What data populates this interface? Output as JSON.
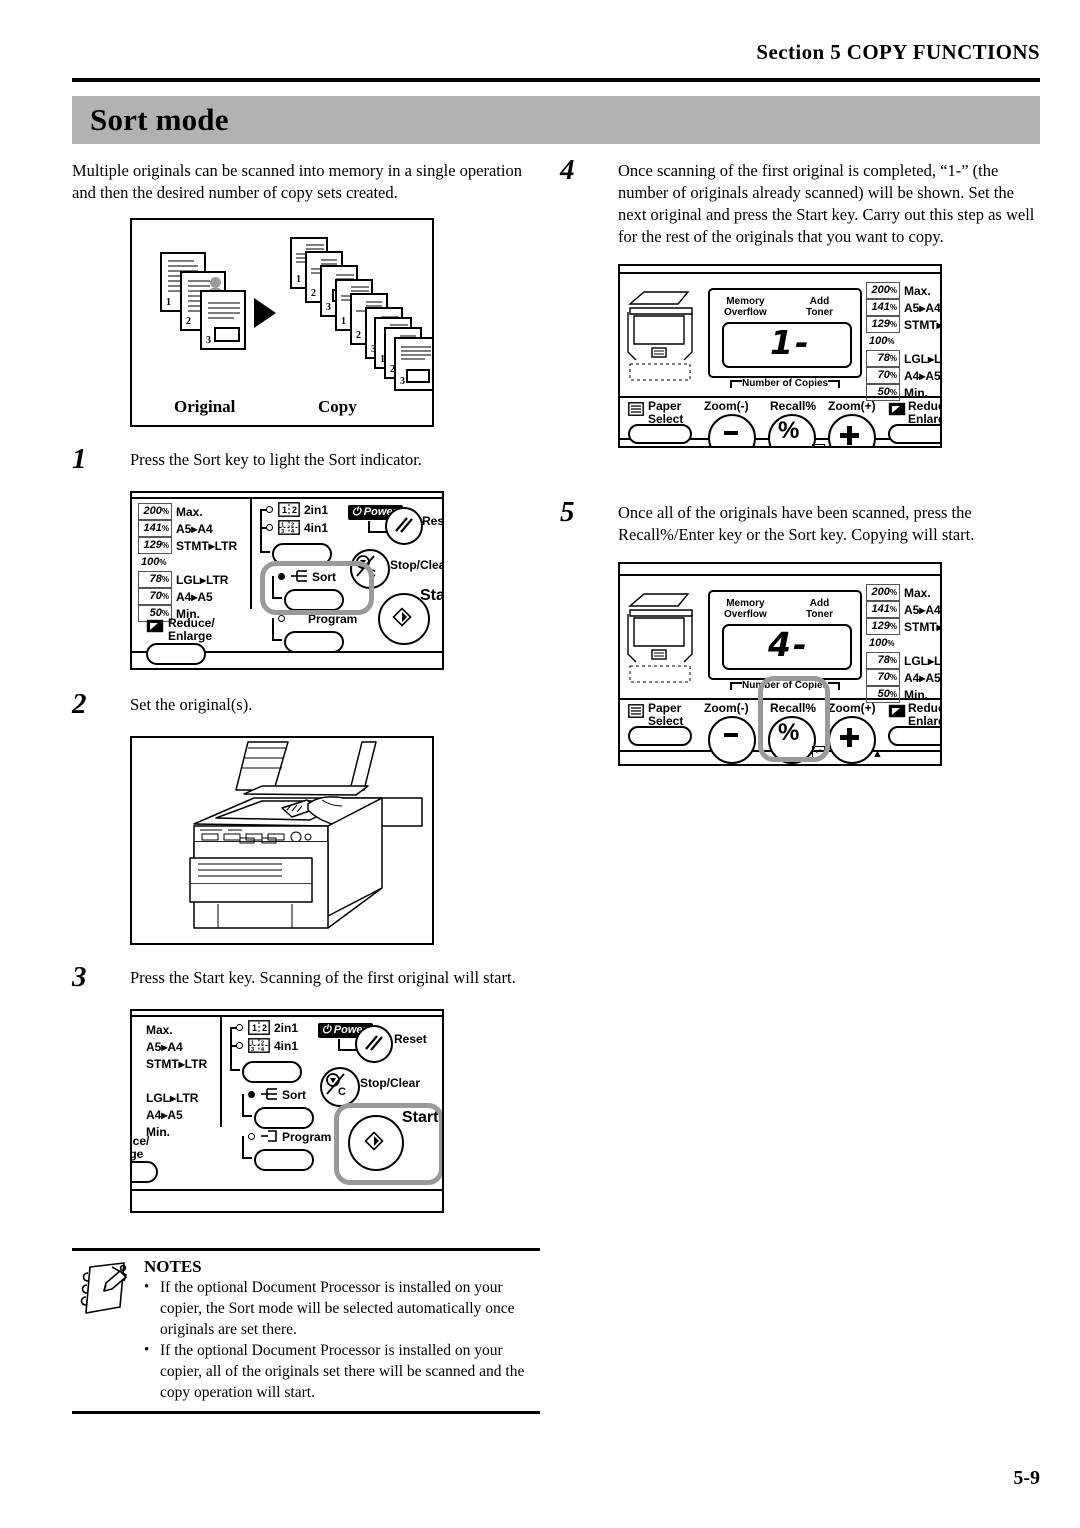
{
  "document": {
    "section_header": "Section 5  COPY FUNCTIONS",
    "title": "Sort mode",
    "page_number": "5-9"
  },
  "intro": "Multiple originals can be scanned into memory in a single operation and then the desired number of copy sets created.",
  "concept_figure": {
    "original_caption": "Original",
    "copy_caption": "Copy",
    "original_labels": [
      "1",
      "2",
      "3"
    ],
    "copy_labels": [
      "1",
      "2",
      "3",
      "1",
      "2",
      "3",
      "1",
      "2",
      "3"
    ]
  },
  "steps": [
    {
      "number": "1",
      "text": "Press the Sort key to light the Sort indicator."
    },
    {
      "number": "2",
      "text": "Set the original(s)."
    },
    {
      "number": "3",
      "text": "Press the Start key. Scanning of the first original will start."
    },
    {
      "number": "4",
      "text": "Once scanning of the first original is completed, “1-” (the number of originals already scanned) will be shown. Set the next original and press the Start key. Carry out this step as well for the rest of the originals that you want to copy."
    },
    {
      "number": "5",
      "text": "Once all of the originals have been scanned, press the Recall%/Enter key or the Sort key. Copying will start."
    }
  ],
  "panel": {
    "ratios": [
      {
        "pct": "200",
        "unit": "%",
        "name": "Max."
      },
      {
        "pct": "141",
        "unit": "%",
        "name": "A5▸A4"
      },
      {
        "pct": "129",
        "unit": "%",
        "name": "STMT▸LTR"
      },
      {
        "pct": "100",
        "unit": "%",
        "name": ""
      },
      {
        "pct": "78",
        "unit": "%",
        "name": "LGL▸LTR"
      },
      {
        "pct": "70",
        "unit": "%",
        "name": "A4▸A5"
      },
      {
        "pct": "50",
        "unit": "%",
        "name": "Min."
      }
    ],
    "keys": {
      "two_in_one": "2in1",
      "four_in_one": "4in1",
      "sort": "Sort",
      "program": "Program",
      "power": "Power",
      "reset": "Reset",
      "stop_clear": "Stop/Clear",
      "start": "Start",
      "reduce_enlarge": "Reduce/\nEnlarge",
      "paper_select": "Paper\nSelect",
      "zoom_minus": "Zoom(-)",
      "zoom_plus": "Zoom(+)",
      "recall": "Recall%"
    },
    "display": {
      "memory_overflow": "Memory\nOverflow",
      "add_toner": "Add\nToner",
      "number_of_copies": "Number of Copies",
      "value_step4": "1-",
      "value_step5": "4-"
    },
    "highlight_color": "#9a9a9a"
  },
  "notes": {
    "title": "NOTES",
    "items": [
      "If the optional Document Processor is installed on your copier, the Sort mode will be selected automatically once originals are set there.",
      "If the optional Document Processor is installed on your copier, all of the originals set there will be scanned and the copy operation will start."
    ]
  }
}
